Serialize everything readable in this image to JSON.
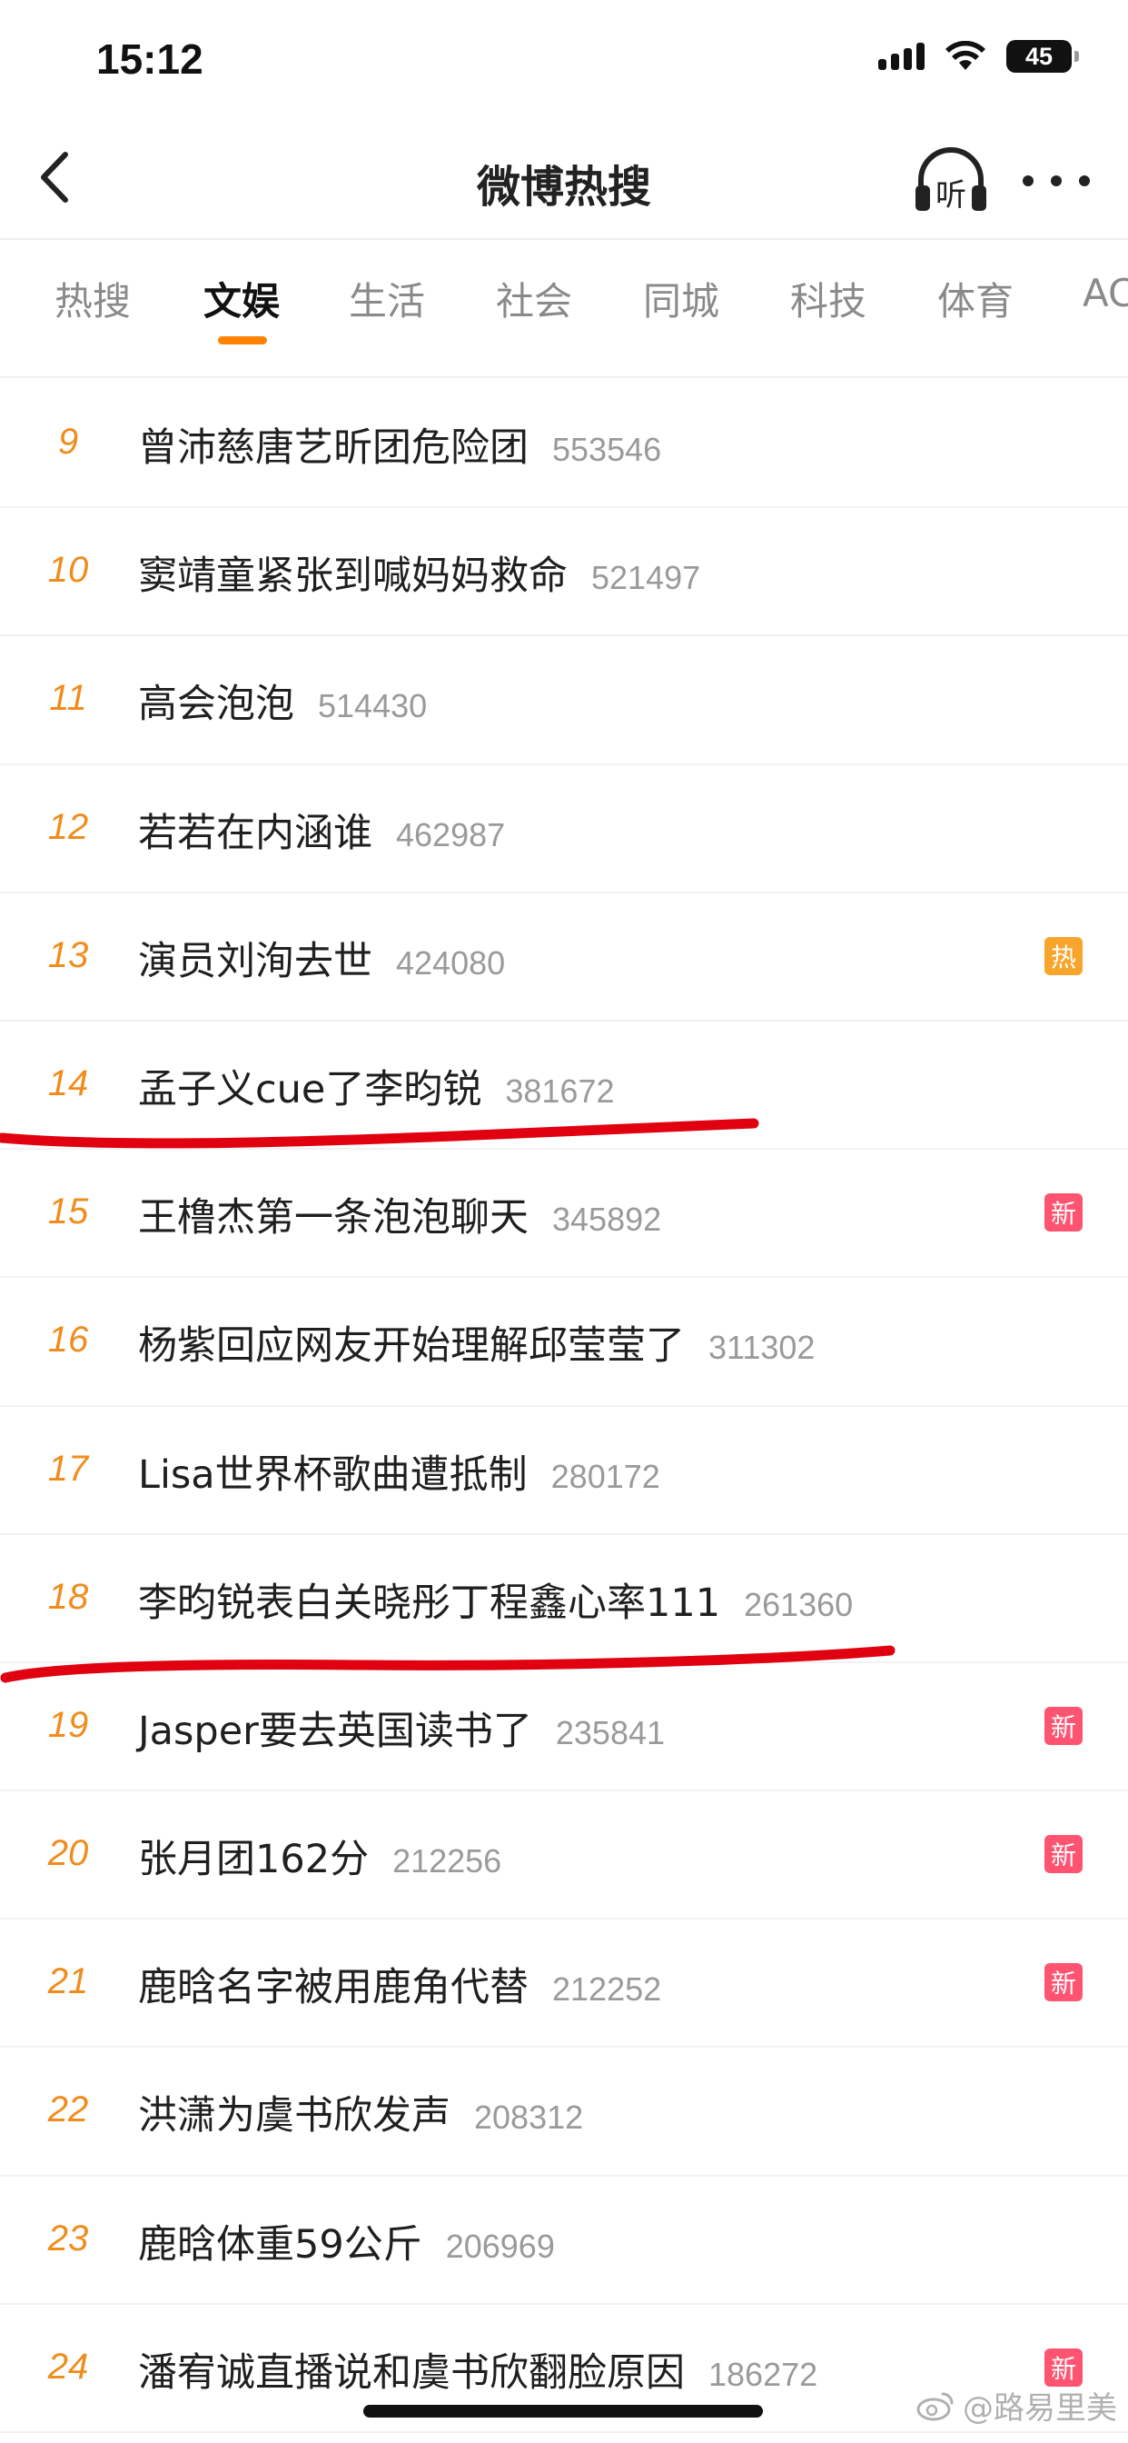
{
  "status_bar": {
    "time": "15:12",
    "battery": "45"
  },
  "nav": {
    "title": "微博热搜",
    "listen_label": "听"
  },
  "tabs": [
    {
      "label": "热搜",
      "active": false
    },
    {
      "label": "文娱",
      "active": true
    },
    {
      "label": "生活",
      "active": false
    },
    {
      "label": "社会",
      "active": false
    },
    {
      "label": "同城",
      "active": false
    },
    {
      "label": "科技",
      "active": false
    },
    {
      "label": "体育",
      "active": false
    },
    {
      "label": "AC",
      "active": false
    }
  ],
  "list": [
    {
      "rank": "9",
      "title": "曾沛慈唐艺昕团危险团",
      "count": "553546",
      "badge": ""
    },
    {
      "rank": "10",
      "title": "窦靖童紧张到喊妈妈救命",
      "count": "521497",
      "badge": ""
    },
    {
      "rank": "11",
      "title": "高会泡泡",
      "count": "514430",
      "badge": ""
    },
    {
      "rank": "12",
      "title": "若若在内涵谁",
      "count": "462987",
      "badge": ""
    },
    {
      "rank": "13",
      "title": "演员刘洵去世",
      "count": "424080",
      "badge": "热"
    },
    {
      "rank": "14",
      "title": "孟子义cue了李昀锐",
      "count": "381672",
      "badge": ""
    },
    {
      "rank": "15",
      "title": "王橹杰第一条泡泡聊天",
      "count": "345892",
      "badge": "新"
    },
    {
      "rank": "16",
      "title": "杨紫回应网友开始理解邱莹莹了",
      "count": "311302",
      "badge": ""
    },
    {
      "rank": "17",
      "title": "Lisa世界杯歌曲遭抵制",
      "count": "280172",
      "badge": ""
    },
    {
      "rank": "18",
      "title": "李昀锐表白关晓彤丁程鑫心率111",
      "count": "261360",
      "badge": ""
    },
    {
      "rank": "19",
      "title": "Jasper要去英国读书了",
      "count": "235841",
      "badge": "新"
    },
    {
      "rank": "20",
      "title": "张月团162分",
      "count": "212256",
      "badge": "新"
    },
    {
      "rank": "21",
      "title": "鹿晗名字被用鹿角代替",
      "count": "212252",
      "badge": "新"
    },
    {
      "rank": "22",
      "title": "洪潇为虞书欣发声",
      "count": "208312",
      "badge": ""
    },
    {
      "rank": "23",
      "title": "鹿晗体重59公斤",
      "count": "206969",
      "badge": ""
    },
    {
      "rank": "24",
      "title": "潘宥诚直播说和虞书欣翻脸原因",
      "count": "186272",
      "badge": "新"
    }
  ],
  "watermark": "@路易里美",
  "colors": {
    "accent": "#ff8200",
    "rank": "#f08c1c",
    "hot_badge": "#f7a52c",
    "new_badge": "#ff5471",
    "annotation": "#e0000f"
  }
}
